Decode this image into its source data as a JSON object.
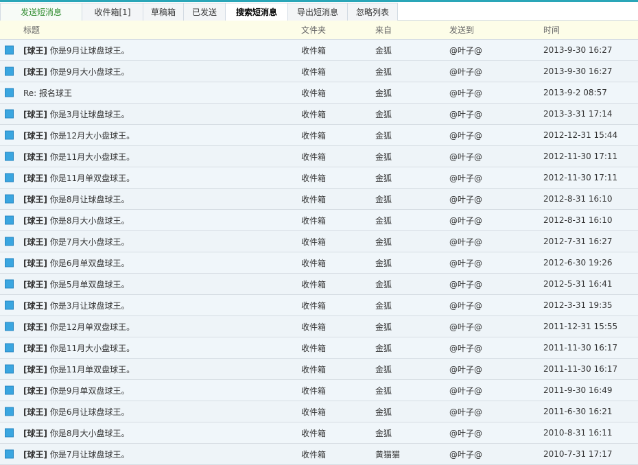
{
  "tabs": [
    {
      "label": "发送短消息",
      "kind": "compose"
    },
    {
      "label": "收件箱[1]",
      "kind": "normal"
    },
    {
      "label": "草稿箱",
      "kind": "normal"
    },
    {
      "label": "已发送",
      "kind": "normal"
    },
    {
      "label": "搜索短消息",
      "kind": "active"
    },
    {
      "label": "导出短消息",
      "kind": "normal"
    },
    {
      "label": "忽略列表",
      "kind": "normal"
    }
  ],
  "columns": {
    "title": "标题",
    "folder": "文件夹",
    "from": "来自",
    "to": "发送到",
    "time": "时间"
  },
  "rows": [
    {
      "tag": "[球王]",
      "title": "你是9月让球盘球王。",
      "folder": "收件箱",
      "from": "金狐",
      "to": "@叶子@",
      "time": "2013-9-30 16:27"
    },
    {
      "tag": "[球王]",
      "title": "你是9月大小盘球王。",
      "folder": "收件箱",
      "from": "金狐",
      "to": "@叶子@",
      "time": "2013-9-30 16:27"
    },
    {
      "tag": "",
      "title": "Re: 报名球王",
      "folder": "收件箱",
      "from": "金狐",
      "to": "@叶子@",
      "time": "2013-9-2 08:57"
    },
    {
      "tag": "[球王]",
      "title": "你是3月让球盘球王。",
      "folder": "收件箱",
      "from": "金狐",
      "to": "@叶子@",
      "time": "2013-3-31 17:14"
    },
    {
      "tag": "[球王]",
      "title": "你是12月大小盘球王。",
      "folder": "收件箱",
      "from": "金狐",
      "to": "@叶子@",
      "time": "2012-12-31 15:44"
    },
    {
      "tag": "[球王]",
      "title": "你是11月大小盘球王。",
      "folder": "收件箱",
      "from": "金狐",
      "to": "@叶子@",
      "time": "2012-11-30 17:11"
    },
    {
      "tag": "[球王]",
      "title": "你是11月单双盘球王。",
      "folder": "收件箱",
      "from": "金狐",
      "to": "@叶子@",
      "time": "2012-11-30 17:11"
    },
    {
      "tag": "[球王]",
      "title": "你是8月让球盘球王。",
      "folder": "收件箱",
      "from": "金狐",
      "to": "@叶子@",
      "time": "2012-8-31 16:10"
    },
    {
      "tag": "[球王]",
      "title": "你是8月大小盘球王。",
      "folder": "收件箱",
      "from": "金狐",
      "to": "@叶子@",
      "time": "2012-8-31 16:10"
    },
    {
      "tag": "[球王]",
      "title": "你是7月大小盘球王。",
      "folder": "收件箱",
      "from": "金狐",
      "to": "@叶子@",
      "time": "2012-7-31 16:27"
    },
    {
      "tag": "[球王]",
      "title": "你是6月单双盘球王。",
      "folder": "收件箱",
      "from": "金狐",
      "to": "@叶子@",
      "time": "2012-6-30 19:26"
    },
    {
      "tag": "[球王]",
      "title": "你是5月单双盘球王。",
      "folder": "收件箱",
      "from": "金狐",
      "to": "@叶子@",
      "time": "2012-5-31 16:41"
    },
    {
      "tag": "[球王]",
      "title": "你是3月让球盘球王。",
      "folder": "收件箱",
      "from": "金狐",
      "to": "@叶子@",
      "time": "2012-3-31 19:35"
    },
    {
      "tag": "[球王]",
      "title": "你是12月单双盘球王。",
      "folder": "收件箱",
      "from": "金狐",
      "to": "@叶子@",
      "time": "2011-12-31 15:55"
    },
    {
      "tag": "[球王]",
      "title": "你是11月大小盘球王。",
      "folder": "收件箱",
      "from": "金狐",
      "to": "@叶子@",
      "time": "2011-11-30 16:17"
    },
    {
      "tag": "[球王]",
      "title": "你是11月单双盘球王。",
      "folder": "收件箱",
      "from": "金狐",
      "to": "@叶子@",
      "time": "2011-11-30 16:17"
    },
    {
      "tag": "[球王]",
      "title": "你是9月单双盘球王。",
      "folder": "收件箱",
      "from": "金狐",
      "to": "@叶子@",
      "time": "2011-9-30 16:49"
    },
    {
      "tag": "[球王]",
      "title": "你是6月让球盘球王。",
      "folder": "收件箱",
      "from": "金狐",
      "to": "@叶子@",
      "time": "2011-6-30 16:21"
    },
    {
      "tag": "[球王]",
      "title": "你是8月大小盘球王。",
      "folder": "收件箱",
      "from": "金狐",
      "to": "@叶子@",
      "time": "2010-8-31 16:11"
    },
    {
      "tag": "[球王]",
      "title": "你是7月让球盘球王。",
      "folder": "收件箱",
      "from": "黄猫猫",
      "to": "@叶子@",
      "time": "2010-7-31 17:17"
    }
  ],
  "icons": {
    "row_icon": "message-icon"
  },
  "colors": {
    "accent": "#2aa6b8",
    "compose_tab": "#2e8b2e",
    "icon": "#3aa6e0",
    "header_bg": "#fdfde8"
  }
}
